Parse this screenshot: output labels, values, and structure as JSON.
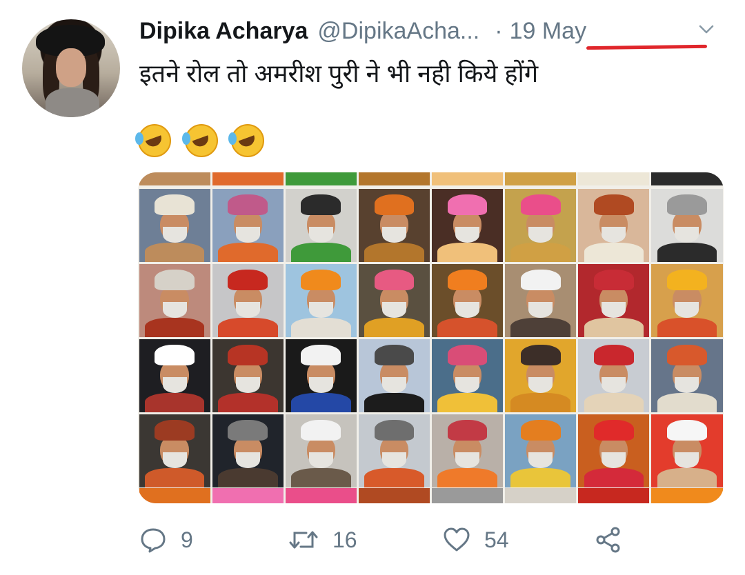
{
  "tweet": {
    "author_name": "Dipika Acharya",
    "author_handle": "@DipikaAcha...",
    "separator": "·",
    "date": "19 May",
    "text": "इतने रोल तो अमरीश पुरी ने भी नही किये होंगे",
    "emojis": [
      "rolling-on-floor-laughing",
      "rolling-on-floor-laughing",
      "rolling-on-floor-laughing"
    ]
  },
  "actions": {
    "reply": {
      "icon": "reply-icon",
      "count": "9"
    },
    "retweet": {
      "icon": "retweet-icon",
      "count": "16"
    },
    "like": {
      "icon": "heart-icon",
      "count": "54"
    },
    "share": {
      "icon": "share-icon"
    }
  },
  "media": {
    "rows": 4,
    "cols": 8,
    "tiles": [
      {
        "bg": "#6e7f96",
        "turban": "#e8e3d5",
        "cloth": "#bd8c5c"
      },
      {
        "bg": "#8aa0bd",
        "turban": "#c05a8a",
        "cloth": "#e06a2c"
      },
      {
        "bg": "#d2d1cc",
        "turban": "#2b2b2b",
        "cloth": "#3f9a3a"
      },
      {
        "bg": "#58412f",
        "turban": "#e0701f",
        "cloth": "#b3762c"
      },
      {
        "bg": "#4a2e25",
        "turban": "#f06fb0",
        "cloth": "#f0c07a"
      },
      {
        "bg": "#c4a24d",
        "turban": "#ea4e8a",
        "cloth": "#d0a044"
      },
      {
        "bg": "#d9b79a",
        "turban": "#b04a22",
        "cloth": "#ede7d7"
      },
      {
        "bg": "#dcdcda",
        "turban": "#9a9a9a",
        "cloth": "#2b2b2b"
      },
      {
        "bg": "#bd8a7c",
        "turban": "#d6d1c8",
        "cloth": "#a8341f"
      },
      {
        "bg": "#c6c6c8",
        "turban": "#c7281f",
        "cloth": "#d74a2b"
      },
      {
        "bg": "#9ec4df",
        "turban": "#f08a1c",
        "cloth": "#e3ded4"
      },
      {
        "bg": "#5a5040",
        "turban": "#e75a82",
        "cloth": "#e0a024"
      },
      {
        "bg": "#6b4e2a",
        "turban": "#f07e1f",
        "cloth": "#d6522c"
      },
      {
        "bg": "#a88e72",
        "turban": "#f2f2f2",
        "cloth": "#4e4038"
      },
      {
        "bg": "#b2282d",
        "turban": "#c82c36",
        "cloth": "#e0c5a0"
      },
      {
        "bg": "#d7a04c",
        "turban": "#f3b21f",
        "cloth": "#d9512a"
      },
      {
        "bg": "#1e1e22",
        "turban": "#ffffff",
        "cloth": "#a8342c"
      },
      {
        "bg": "#3c3630",
        "turban": "#b73424",
        "cloth": "#b3312a"
      },
      {
        "bg": "#1a1a1a",
        "turban": "#f2f2f2",
        "cloth": "#2448a6"
      },
      {
        "bg": "#b8c6d8",
        "turban": "#4a4a4a",
        "cloth": "#1c1c1c"
      },
      {
        "bg": "#4b6e8a",
        "turban": "#d94d77",
        "cloth": "#f0c038"
      },
      {
        "bg": "#e1a62c",
        "turban": "#3c2e28",
        "cloth": "#d58a22"
      },
      {
        "bg": "#c8ccd2",
        "turban": "#c9272d",
        "cloth": "#e4d3b8"
      },
      {
        "bg": "#66758a",
        "turban": "#d8592c",
        "cloth": "#e2dccd"
      },
      {
        "bg": "#3b3733",
        "turban": "#9c3b22",
        "cloth": "#cf5a2a"
      },
      {
        "bg": "#20242b",
        "turban": "#7a7a7a",
        "cloth": "#4a3a30"
      },
      {
        "bg": "#c6c3bd",
        "turban": "#f2f2f2",
        "cloth": "#6a5a4a"
      },
      {
        "bg": "#c4c9cf",
        "turban": "#6e6e6e",
        "cloth": "#d85a2a"
      },
      {
        "bg": "#b9b0a8",
        "turban": "#c23a45",
        "cloth": "#ef7a2a"
      },
      {
        "bg": "#7aa2c2",
        "turban": "#e47e1f",
        "cloth": "#e9c53a"
      },
      {
        "bg": "#c95f1f",
        "turban": "#e02a2a",
        "cloth": "#d42a3a"
      },
      {
        "bg": "#e33c2c",
        "turban": "#f6f6f6",
        "cloth": "#d7b08a"
      }
    ]
  }
}
